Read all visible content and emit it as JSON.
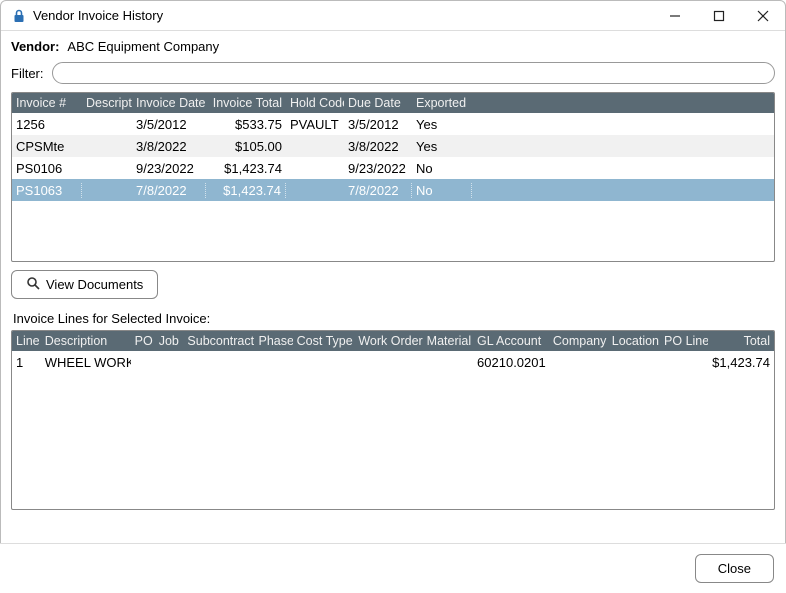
{
  "window": {
    "title": "Vendor Invoice History"
  },
  "vendor": {
    "label": "Vendor:",
    "name": "ABC Equipment Company"
  },
  "filter": {
    "label": "Filter:",
    "value": ""
  },
  "invoice_table": {
    "headers": {
      "invoice_no": "Invoice #",
      "description": "Description",
      "invoice_date": "Invoice Date",
      "invoice_total": "Invoice Total",
      "hold_code": "Hold Code",
      "due_date": "Due Date",
      "exported": "Exported"
    },
    "rows": [
      {
        "invoice_no": "1256",
        "description": "",
        "invoice_date": "3/5/2012",
        "invoice_total": "$533.75",
        "hold_code": "PVAULT",
        "due_date": "3/5/2012",
        "exported": "Yes"
      },
      {
        "invoice_no": "CPSMte",
        "description": "",
        "invoice_date": "3/8/2022",
        "invoice_total": "$105.00",
        "hold_code": "",
        "due_date": "3/8/2022",
        "exported": "Yes"
      },
      {
        "invoice_no": "PS0106",
        "description": "",
        "invoice_date": "9/23/2022",
        "invoice_total": "$1,423.74",
        "hold_code": "",
        "due_date": "9/23/2022",
        "exported": "No"
      },
      {
        "invoice_no": "PS1063",
        "description": "",
        "invoice_date": "7/8/2022",
        "invoice_total": "$1,423.74",
        "hold_code": "",
        "due_date": "7/8/2022",
        "exported": "No"
      }
    ],
    "selected_index": 3
  },
  "view_documents_label": "View Documents",
  "lines_section_label": "Invoice Lines for Selected Invoice:",
  "lines_table": {
    "headers": {
      "line": "Line",
      "description": "Description",
      "po": "PO",
      "job": "Job",
      "subcontract": "Subcontract",
      "phase": "Phase",
      "cost_type": "Cost Type",
      "work_order": "Work Order",
      "material": "Material",
      "gl_account": "GL Account",
      "company": "Company",
      "location": "Location",
      "po_line": "PO Line",
      "total": "Total"
    },
    "rows": [
      {
        "line": "1",
        "description": "WHEEL WORK",
        "po": "",
        "job": "",
        "subcontract": "",
        "phase": "",
        "cost_type": "",
        "work_order": "",
        "material": "",
        "gl_account": "60210.0201",
        "company": "",
        "location": "",
        "po_line": "",
        "total": "$1,423.74"
      }
    ]
  },
  "close_label": "Close"
}
